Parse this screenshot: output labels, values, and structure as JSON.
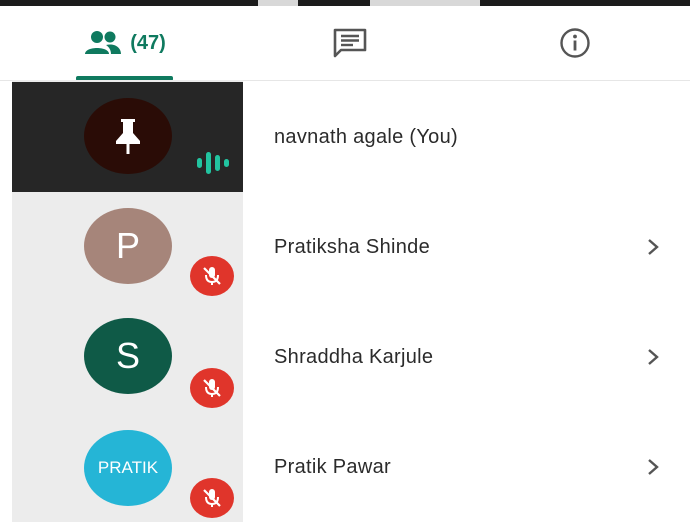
{
  "tabs": {
    "people": {
      "icon": "people-icon",
      "count": "(47)",
      "selected": true
    },
    "chat": {
      "icon": "chat-icon"
    },
    "info": {
      "icon": "info-icon"
    }
  },
  "participants": [
    {
      "name": "navnath agale (You)",
      "avatar_icon": "pin-icon",
      "status": "speaking",
      "has_chevron": false
    },
    {
      "name": "Pratiksha Shinde",
      "avatar_text": "P",
      "avatar_color": "#a6857a",
      "status": "muted",
      "has_chevron": true
    },
    {
      "name": "Shraddha Karjule",
      "avatar_text": "S",
      "avatar_color": "#0f5a47",
      "status": "muted",
      "has_chevron": true
    },
    {
      "name": "Pratik Pawar",
      "avatar_text": "PRATIK",
      "avatar_color": "#25b5d6",
      "status": "muted",
      "has_chevron": true
    }
  ],
  "colors": {
    "accent": "#0f7a5f",
    "muted_badge": "#e0352b",
    "speaking_tile": "#262626"
  }
}
